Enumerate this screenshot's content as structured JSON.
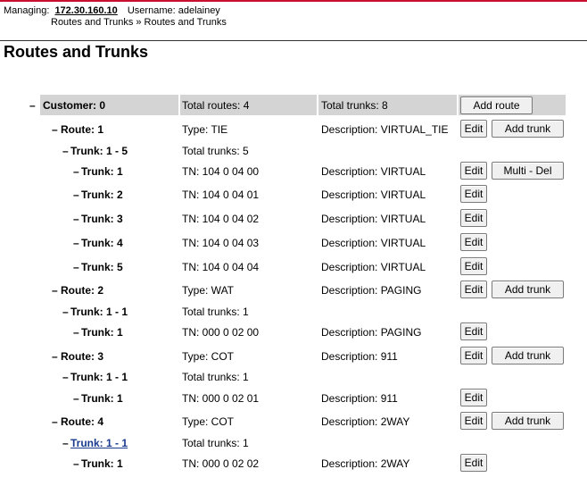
{
  "header": {
    "managing_label": "Managing:",
    "managing_ip": "172.30.160.10",
    "username_label": "Username: adelainey",
    "breadcrumb": "Routes and Trunks » Routes and Trunks"
  },
  "page_title": "Routes and Trunks",
  "customer": {
    "toggle": "–",
    "name": "Customer: 0",
    "total_routes": "Total routes: 4",
    "total_trunks": "Total trunks: 8",
    "add_route_label": "Add route"
  },
  "labels": {
    "edit": "Edit",
    "add_trunk": "Add trunk",
    "multi_del": "Multi - Del"
  },
  "rows": [
    {
      "kind": "route",
      "toggle": "–",
      "name": "Route: 1",
      "col2": "Type: TIE",
      "col3": "Description: VIRTUAL_TIE",
      "edit": true,
      "second": "add_trunk"
    },
    {
      "kind": "group",
      "toggle": "–",
      "name": "Trunk: 1 - 5",
      "col2": "Total trunks: 5",
      "col3": "",
      "edit": false,
      "second": ""
    },
    {
      "kind": "trunk",
      "toggle": "–",
      "name": "Trunk: 1",
      "col2": "TN: 104 0 04 00",
      "col3": "Description: VIRTUAL",
      "edit": true,
      "second": "multi_del"
    },
    {
      "kind": "trunk",
      "toggle": "–",
      "name": "Trunk: 2",
      "col2": "TN: 104 0 04 01",
      "col3": "Description: VIRTUAL",
      "edit": true,
      "second": ""
    },
    {
      "kind": "trunk",
      "toggle": "–",
      "name": "Trunk: 3",
      "col2": "TN: 104 0 04 02",
      "col3": "Description: VIRTUAL",
      "edit": true,
      "second": ""
    },
    {
      "kind": "trunk",
      "toggle": "–",
      "name": "Trunk: 4",
      "col2": "TN: 104 0 04 03",
      "col3": "Description: VIRTUAL",
      "edit": true,
      "second": ""
    },
    {
      "kind": "trunk",
      "toggle": "–",
      "name": "Trunk: 5",
      "col2": "TN: 104 0 04 04",
      "col3": "Description: VIRTUAL",
      "edit": true,
      "second": ""
    },
    {
      "kind": "route",
      "toggle": "–",
      "name": "Route: 2",
      "col2": "Type: WAT",
      "col3": "Description: PAGING",
      "edit": true,
      "second": "add_trunk"
    },
    {
      "kind": "group",
      "toggle": "–",
      "name": "Trunk: 1 - 1",
      "col2": "Total trunks: 1",
      "col3": "",
      "edit": false,
      "second": ""
    },
    {
      "kind": "trunk",
      "toggle": "–",
      "name": "Trunk: 1",
      "col2": "TN: 000 0 02 00",
      "col3": "Description: PAGING",
      "edit": true,
      "second": ""
    },
    {
      "kind": "route",
      "toggle": "–",
      "name": "Route: 3",
      "col2": "Type: COT",
      "col3": "Description: 911",
      "edit": true,
      "second": "add_trunk"
    },
    {
      "kind": "group",
      "toggle": "–",
      "name": "Trunk: 1 - 1",
      "col2": "Total trunks: 1",
      "col3": "",
      "edit": false,
      "second": ""
    },
    {
      "kind": "trunk",
      "toggle": "–",
      "name": "Trunk: 1",
      "col2": "TN: 000 0 02 01",
      "col3": "Description: 911",
      "edit": true,
      "second": ""
    },
    {
      "kind": "route",
      "toggle": "–",
      "name": "Route: 4",
      "col2": "Type: COT",
      "col3": "Description: 2WAY",
      "edit": true,
      "second": "add_trunk"
    },
    {
      "kind": "group",
      "toggle": "–",
      "name": "Trunk: 1 - 1",
      "col2": "Total trunks: 1",
      "col3": "",
      "edit": false,
      "second": "",
      "link": true
    },
    {
      "kind": "trunk",
      "toggle": "–",
      "name": "Trunk: 1",
      "col2": "TN: 000 0 02 02",
      "col3": "Description: 2WAY",
      "edit": true,
      "second": ""
    }
  ]
}
